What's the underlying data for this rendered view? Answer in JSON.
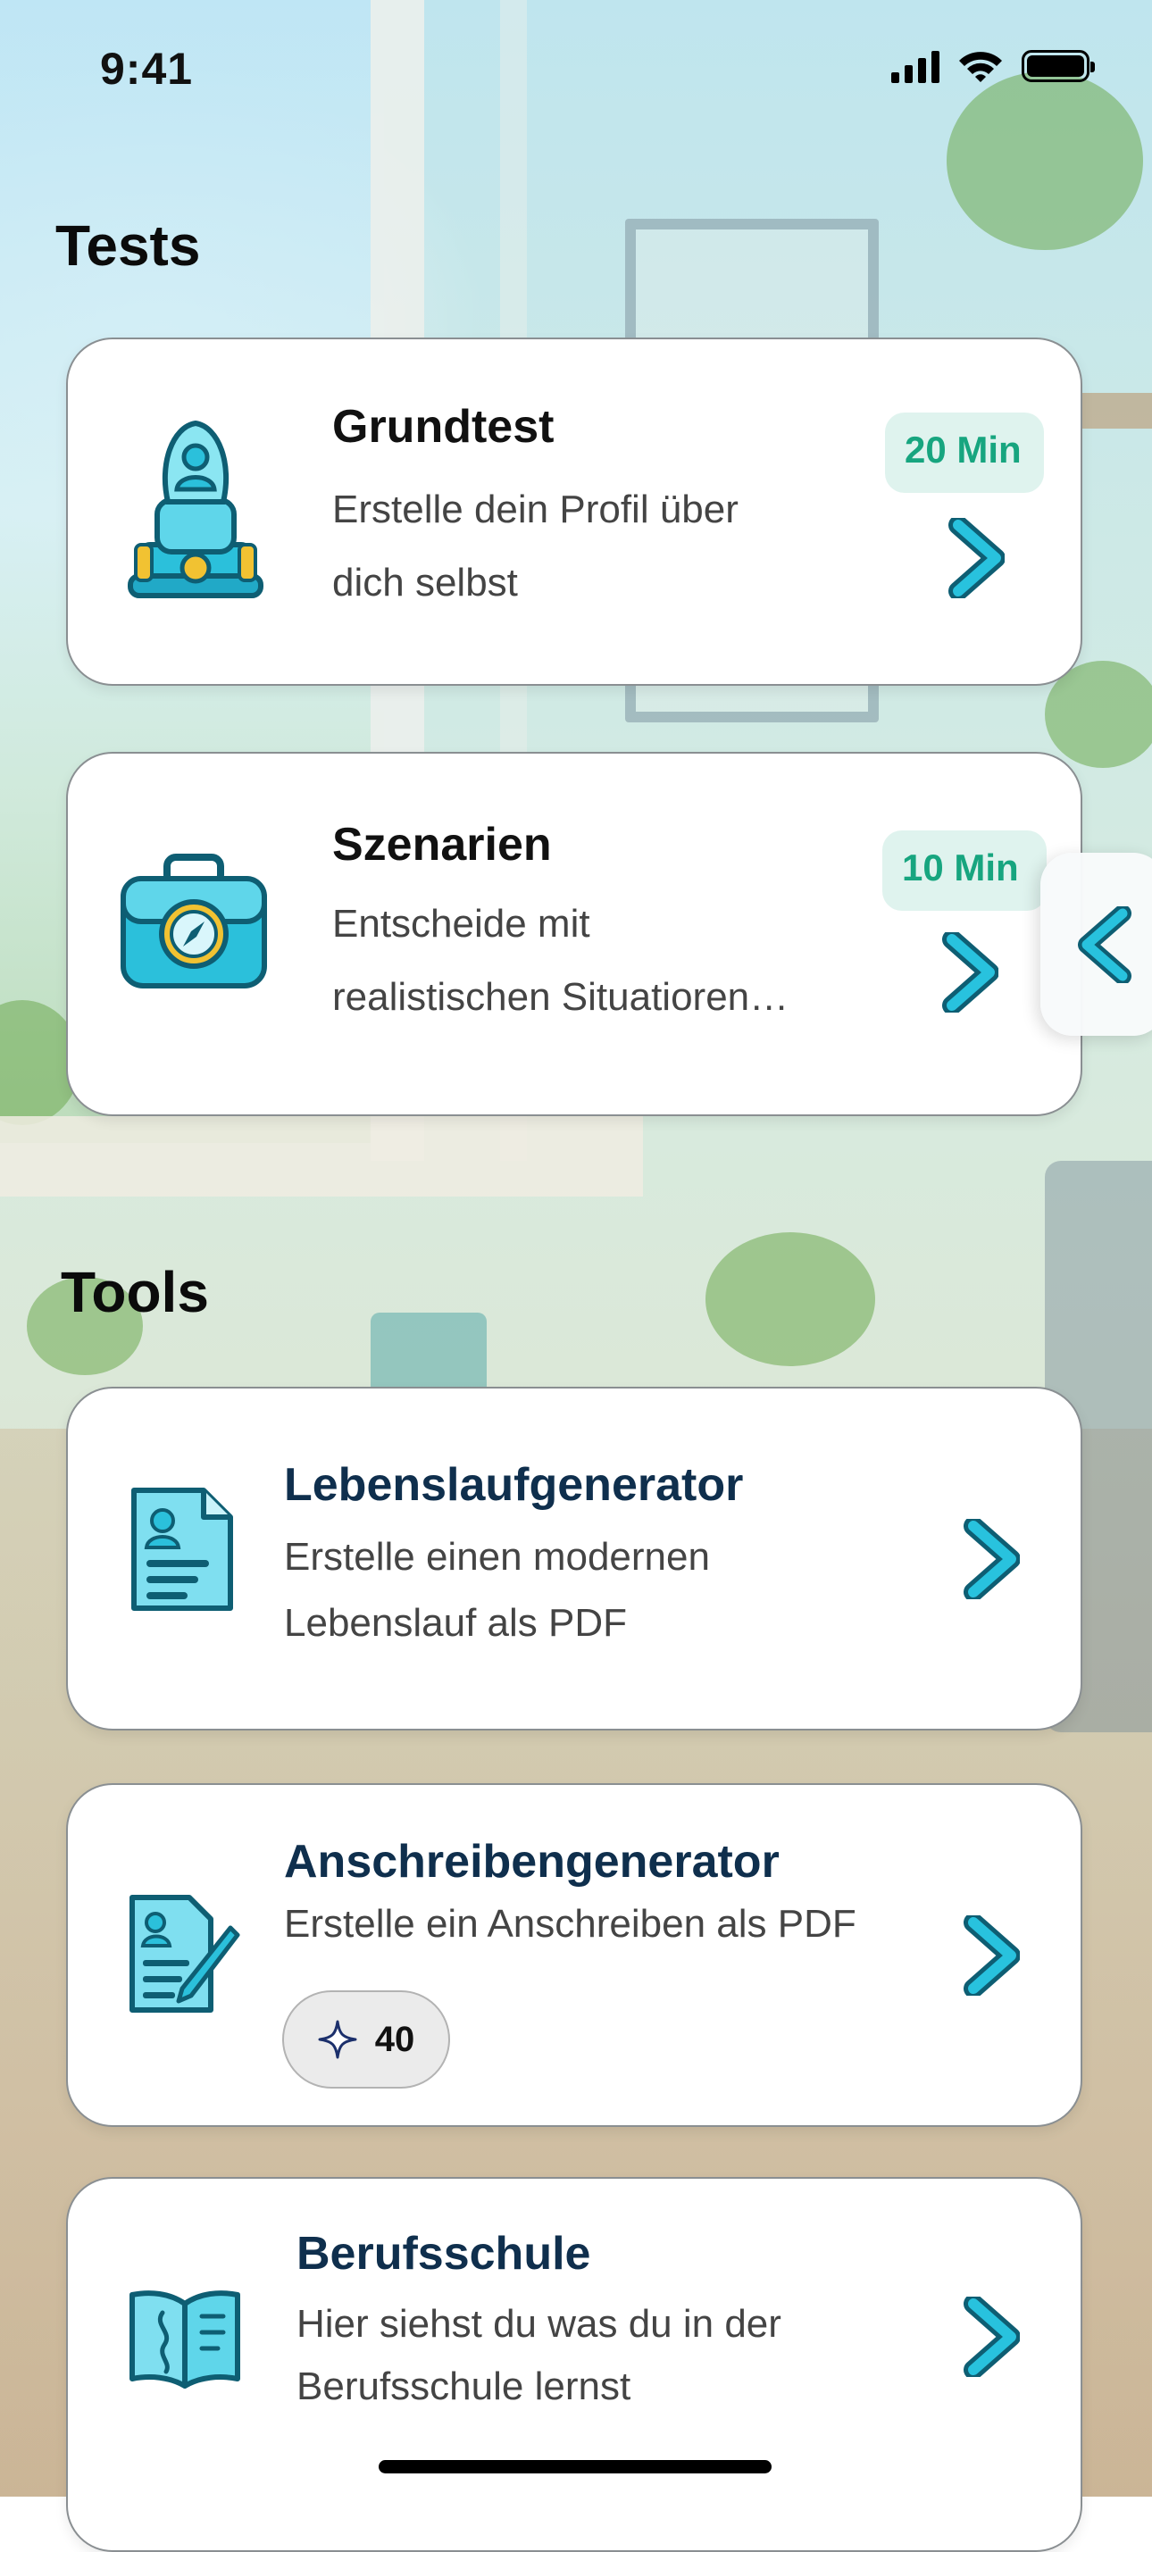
{
  "status_bar": {
    "time": "9:41"
  },
  "tests": {
    "heading": "Tests",
    "cards": [
      {
        "title": "Grundtest",
        "description_line1": "Erstelle dein Profil über",
        "description_line2": "dich selbst",
        "duration": "20 Min",
        "icon": "profile-podium-icon"
      },
      {
        "title": "Szenarien",
        "description_line1": "Entscheide mit",
        "description_line2": "realistischen Situatioren…",
        "duration": "10 Min",
        "icon": "briefcase-compass-icon"
      }
    ]
  },
  "tools": {
    "heading": "Tools",
    "cards": [
      {
        "title": "Lebenslaufgenerator",
        "description_line1": "Erstelle einen modernen",
        "description_line2": "Lebenslauf als PDF",
        "icon": "resume-document-icon"
      },
      {
        "title": "Anschreibengenerator",
        "description_line1": "Erstelle ein Anschreiben als PDF",
        "credits": "40",
        "icon": "cover-letter-pen-icon"
      },
      {
        "title": "Berufsschule",
        "description_line1": "Hier siehst du was du in der",
        "description_line2": "Berufsschule lernst",
        "icon": "open-book-icon"
      }
    ]
  },
  "colors": {
    "accent": "#1fb6d6",
    "badge_bg": "#dff3ee",
    "badge_text": "#17a57f",
    "tool_title": "#0f2f4d"
  }
}
